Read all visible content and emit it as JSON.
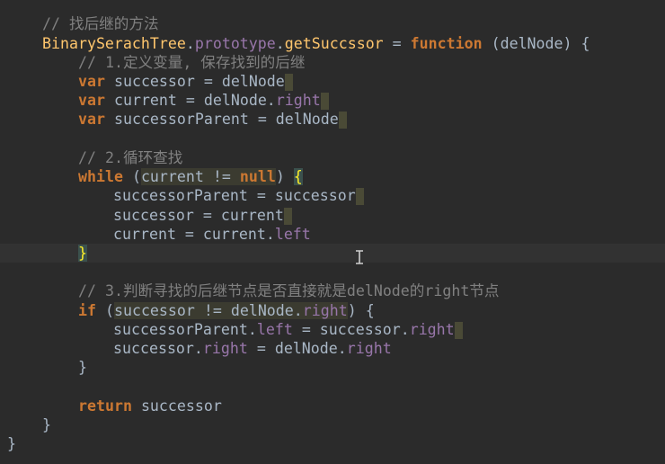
{
  "editor": {
    "lines": {
      "l1_comment": "// 找后继的方法",
      "l2_class": "BinarySerachTree",
      "l2_dot1": ".",
      "l2_proto": "prototype",
      "l2_dot2": ".",
      "l2_method": "getSuccssor",
      "l2_eq": " = ",
      "l2_function": "function",
      "l2_params": " (delNode) {",
      "l3_comment": "// 1.定义变量, 保存找到的后继",
      "l4_var": "var",
      "l4_rest": " successor = delNode",
      "l5_var": "var",
      "l5_rest": " current = delNode.",
      "l5_prop": "right",
      "l6_var": "var",
      "l6_rest": " successorParent = delNode",
      "l8_comment": "// 2.循环查找",
      "l9_while": "while",
      "l9_open": " (",
      "l9_cond1": "current != ",
      "l9_null": "null",
      "l9_close": ") ",
      "l9_brace": "{",
      "l10_code": "successorParent = successor",
      "l11_code": "successor = current",
      "l12_code": "current = current.",
      "l12_prop": "left",
      "l13_brace": "}",
      "l15_comment": "// 3.判断寻找的后继节点是否直接就是delNode的right节点",
      "l16_if": "if",
      "l16_open": " (",
      "l16_cond": "successor != delNode.",
      "l16_prop": "right",
      "l16_close": ") {",
      "l17_code1": "successorParent.",
      "l17_prop1": "left",
      "l17_code2": " = successor.",
      "l17_prop2": "right",
      "l18_code1": "successor.",
      "l18_prop1": "right",
      "l18_code2": " = delNode.",
      "l18_prop2": "right",
      "l19_brace": "}",
      "l21_return": "return",
      "l21_rest": " successor",
      "l22_brace": "}",
      "l23_brace": "}"
    },
    "colors": {
      "background": "#2b2b2b",
      "keyword": "#cc7832",
      "function_name": "#ffc66d",
      "property": "#9876aa",
      "comment": "#808080",
      "text": "#a9b7c6"
    }
  }
}
